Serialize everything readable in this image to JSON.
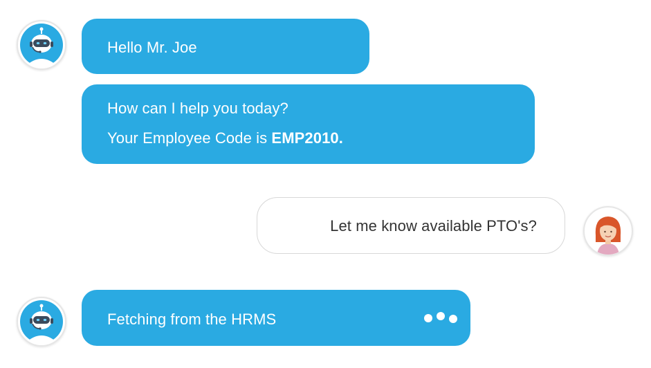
{
  "bot": {
    "avatar_icon": "robot-icon",
    "greeting": "Hello Mr. Joe",
    "help_line": "How can I help you today?",
    "code_prefix": "Your Employee Code is ",
    "code_value": "EMP2010.",
    "status": "Fetching from the HRMS",
    "typing_icon": "typing-dots-icon"
  },
  "user": {
    "avatar_icon": "user-avatar-icon",
    "message": "Let me know available PTO's?"
  },
  "colors": {
    "bot_bubble": "#2aaae2",
    "user_bubble_border": "#d7d7d7",
    "user_text": "#333333"
  }
}
